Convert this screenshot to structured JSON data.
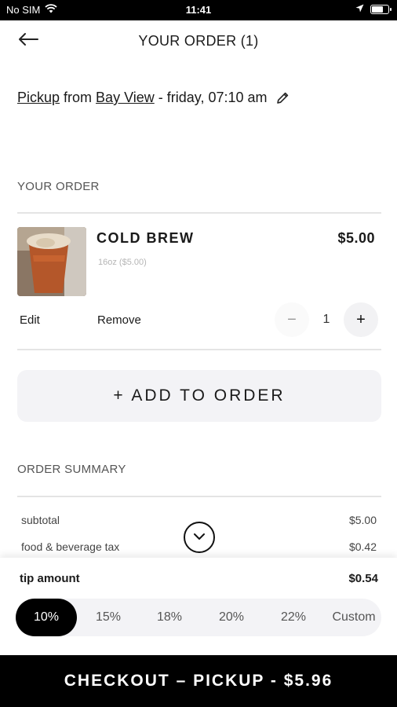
{
  "status_bar": {
    "carrier": "No SIM",
    "time": "11:41",
    "battery_level": 0.75
  },
  "header": {
    "title": "YOUR ORDER (1)"
  },
  "pickup": {
    "mode": "Pickup",
    "from_word": " from ",
    "location": "Bay View",
    "time": " - friday, 07:10 am"
  },
  "order_section": {
    "heading": "YOUR ORDER"
  },
  "item": {
    "name": "COLD BREW",
    "price": "$5.00",
    "detail": "16oz ($5.00)",
    "edit_label": "Edit",
    "remove_label": "Remove",
    "minus": "−",
    "quantity": "1",
    "plus": "+"
  },
  "add_to_order": {
    "label": "+ ADD TO ORDER"
  },
  "summary": {
    "heading": "ORDER SUMMARY",
    "rows": [
      {
        "label": "subtotal",
        "value": "$5.00"
      },
      {
        "label": "food & beverage tax",
        "value": "$0.42"
      }
    ]
  },
  "tip": {
    "label": "tip amount",
    "value": "$0.54",
    "options": [
      "10%",
      "15%",
      "18%",
      "20%",
      "22%",
      "Custom"
    ],
    "selected_index": 0
  },
  "checkout": {
    "label": "CHECKOUT – PICKUP - $5.96"
  },
  "colors": {
    "accent": "#000000",
    "surface": "#f3f3f6",
    "divider": "#e4e4e4"
  },
  "icons": {
    "back": "arrow-left-icon",
    "edit": "pencil-icon",
    "expand": "chevron-down-icon",
    "wifi": "wifi-icon",
    "location": "location-arrow-icon",
    "battery": "battery-icon"
  }
}
